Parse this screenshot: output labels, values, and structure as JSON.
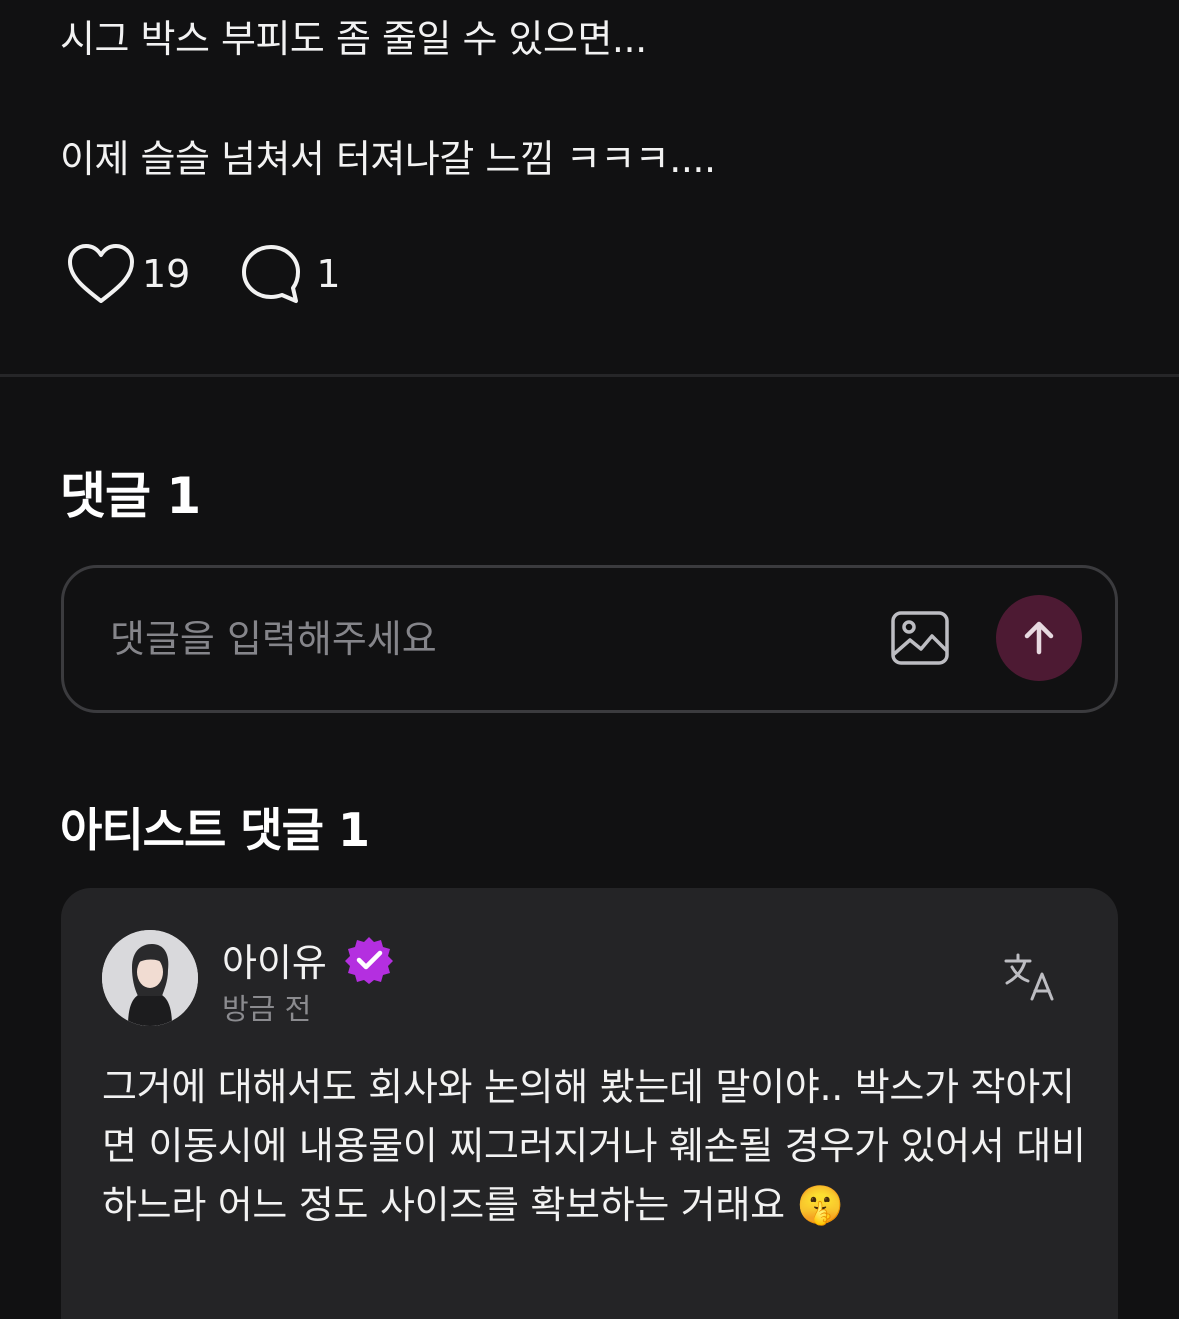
{
  "post": {
    "line1": "시그 박스 부피도 좀 줄일 수 있으면...",
    "line2": "이제 슬슬 넘쳐서 터져나갈 느낌 ㅋㅋㅋ....",
    "like_count": "19",
    "comment_count": "1",
    "like_icon": "heart-outline-icon",
    "comment_icon": "speech-bubble-icon"
  },
  "comments": {
    "heading": "댓글 1",
    "input_placeholder": "댓글을 입력해주세요",
    "image_icon": "image-icon",
    "send_icon": "arrow-up-icon",
    "send_button_color": "#4d1a33"
  },
  "artist_comments": {
    "heading": "아티스트 댓글 1",
    "items": [
      {
        "author": "아이유",
        "verified_icon": "verified-badge-icon",
        "verified_color": "#b42fe0",
        "time": "방금 전",
        "translate_icon": "translate-icon",
        "text": "그거에 대해서도 회사와 논의해 봤는데 말이야.. 박스가 작아지면 이동시에 내용물이 찌그러지거나 훼손될 경우가 있어서 대비하느라 어느 정도 사이즈를 확보하는 거래요 🤫"
      }
    ]
  }
}
